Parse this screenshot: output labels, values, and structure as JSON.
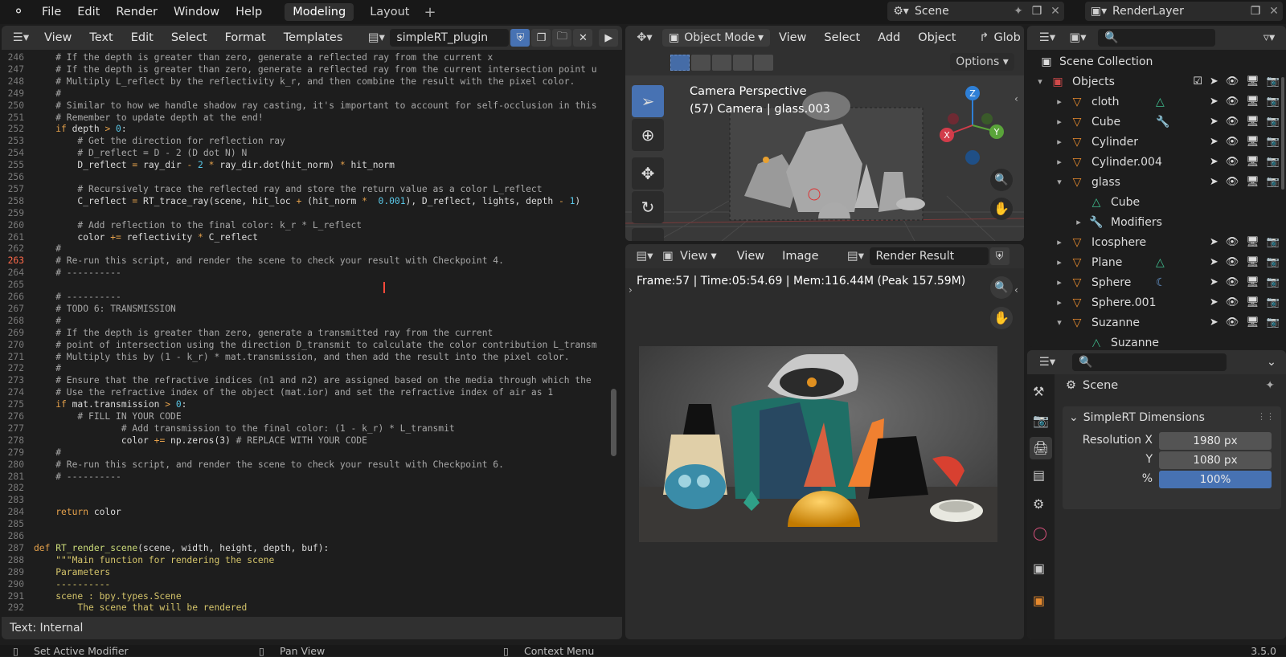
{
  "topbar": {
    "menus": [
      "File",
      "Edit",
      "Render",
      "Window",
      "Help"
    ],
    "workspaces": [
      "Modeling",
      "Layout"
    ],
    "scene": "Scene",
    "view_layer": "RenderLayer"
  },
  "text_editor": {
    "menus": [
      "View",
      "Text",
      "Edit",
      "Select",
      "Format",
      "Templates"
    ],
    "filename": "simpleRT_plugin",
    "status": "Text: Internal",
    "lines": [
      {
        "n": "246",
        "t": "    # If the depth is greater than zero, generate a reflected ray from the current x",
        "c": "cm"
      },
      {
        "n": "247",
        "t": "    # If the depth is greater than zero, generate a reflected ray from the current intersection point using",
        "c": "cm"
      },
      {
        "n": "248",
        "t": "    # Multiply L_reflect by the reflectivity k_r, and then combine the result with the pixel color.",
        "c": "cm"
      },
      {
        "n": "249",
        "t": "    #",
        "c": "cm"
      },
      {
        "n": "250",
        "t": "    # Similar to how we handle shadow ray casting, it's important to account for self-occlusion in this cont",
        "c": "cm"
      },
      {
        "n": "251",
        "t": "    # Remember to update depth at the end!",
        "c": "cm"
      },
      {
        "n": "252",
        "t": "    if depth > 0:",
        "c": "mix1"
      },
      {
        "n": "253",
        "t": "        # Get the direction for reflection ray",
        "c": "cm"
      },
      {
        "n": "254",
        "t": "        # D_reflect = D - 2 (D dot N) N",
        "c": "cm"
      },
      {
        "n": "255",
        "t": "        D_reflect = ray_dir - 2 * ray_dir.dot(hit_norm) * hit_norm",
        "c": "mix2"
      },
      {
        "n": "256",
        "t": "",
        "c": ""
      },
      {
        "n": "257",
        "t": "        # Recursively trace the reflected ray and store the return value as a color L_reflect",
        "c": "cm"
      },
      {
        "n": "258",
        "t": "        C_reflect = RT_trace_ray(scene, hit_loc + (hit_norm *  0.001), D_reflect, lights, depth - 1)",
        "c": "mix3"
      },
      {
        "n": "259",
        "t": "",
        "c": ""
      },
      {
        "n": "260",
        "t": "        # Add reflection to the final color: k_r * L_reflect",
        "c": "cm"
      },
      {
        "n": "261",
        "t": "        color += reflectivity * C_reflect",
        "c": "mix4"
      },
      {
        "n": "262",
        "t": "    #",
        "c": "cm"
      },
      {
        "n": "263",
        "t": "    # Re-run this script, and render the scene to check your result with Checkpoint 4.",
        "c": "cm"
      },
      {
        "n": "264",
        "t": "    # ----------",
        "c": "cm"
      },
      {
        "n": "265",
        "t": "",
        "c": ""
      },
      {
        "n": "266",
        "t": "    # ----------",
        "c": "cm"
      },
      {
        "n": "267",
        "t": "    # TODO 6: TRANSMISSION",
        "c": "cm"
      },
      {
        "n": "268",
        "t": "    #",
        "c": "cm"
      },
      {
        "n": "269",
        "t": "    # If the depth is greater than zero, generate a transmitted ray from the current",
        "c": "cm"
      },
      {
        "n": "270",
        "t": "    # point of intersection using the direction D_transmit to calculate the color contribution L_transmit.",
        "c": "cm"
      },
      {
        "n": "271",
        "t": "    # Multiply this by (1 - k_r) * mat.transmission, and then add the result into the pixel color.",
        "c": "cm"
      },
      {
        "n": "272",
        "t": "    #",
        "c": "cm"
      },
      {
        "n": "273",
        "t": "    # Ensure that the refractive indices (n1 and n2) are assigned based on the media through which the ray i",
        "c": "cm"
      },
      {
        "n": "274",
        "t": "    # Use the refractive index of the object (mat.ior) and set the refractive index of air as 1",
        "c": "cm"
      },
      {
        "n": "275",
        "t": "    if mat.transmission > 0:",
        "c": "mix5"
      },
      {
        "n": "276",
        "t": "        # FILL IN YOUR CODE",
        "c": "cm"
      },
      {
        "n": "277",
        "t": "                # Add transmission to the final color: (1 - k_r) * L_transmit",
        "c": "cm"
      },
      {
        "n": "278",
        "t": "                color += np.zeros(3) # REPLACE WITH YOUR CODE",
        "c": "mix6"
      },
      {
        "n": "279",
        "t": "    #",
        "c": "cm"
      },
      {
        "n": "280",
        "t": "    # Re-run this script, and render the scene to check your result with Checkpoint 6.",
        "c": "cm"
      },
      {
        "n": "281",
        "t": "    # ----------",
        "c": "cm"
      },
      {
        "n": "282",
        "t": "",
        "c": ""
      },
      {
        "n": "283",
        "t": "",
        "c": ""
      },
      {
        "n": "284",
        "t": "    return color",
        "c": "mix7"
      },
      {
        "n": "285",
        "t": "",
        "c": ""
      },
      {
        "n": "286",
        "t": "",
        "c": ""
      },
      {
        "n": "287",
        "t": "def RT_render_scene(scene, width, height, depth, buf):",
        "c": "mix8"
      },
      {
        "n": "288",
        "t": "    \"\"\"Main function for rendering the scene",
        "c": "st"
      },
      {
        "n": "289",
        "t": "    Parameters",
        "c": "st"
      },
      {
        "n": "290",
        "t": "    ----------",
        "c": "st"
      },
      {
        "n": "291",
        "t": "    scene : bpy.types.Scene",
        "c": "st"
      },
      {
        "n": "292",
        "t": "        The scene that will be rendered",
        "c": "st"
      }
    ],
    "current_line": "263"
  },
  "viewport": {
    "mode": "Object Mode",
    "menus": [
      "View",
      "Select",
      "Add",
      "Object"
    ],
    "transform": "Glob",
    "options": "Options",
    "overlay_title": "Camera Perspective",
    "overlay_sub": "(57) Camera | glass.003",
    "gizmo": {
      "x": "X",
      "y": "Y",
      "z": "Z"
    }
  },
  "image_editor": {
    "menus": [
      "View",
      "View",
      "Image"
    ],
    "image_name": "Render Result",
    "stats": "Frame:57 | Time:05:54.69 | Mem:116.44M (Peak 157.59M)"
  },
  "outliner": {
    "root": "Scene Collection",
    "items": [
      {
        "label": "Objects",
        "depth": 0,
        "type": "collection"
      },
      {
        "label": "cloth",
        "depth": 1,
        "type": "object",
        "badge": "mesh-data-icon"
      },
      {
        "label": "Cube",
        "depth": 1,
        "type": "object",
        "badge": "wrench-icon"
      },
      {
        "label": "Cylinder",
        "depth": 1,
        "type": "object",
        "badge": ""
      },
      {
        "label": "Cylinder.004",
        "depth": 1,
        "type": "object",
        "badge": ""
      },
      {
        "label": "glass",
        "depth": 1,
        "type": "object",
        "badge": ""
      },
      {
        "label": "Cube",
        "depth": 2,
        "type": "mesh",
        "badge": ""
      },
      {
        "label": "Modifiers",
        "depth": 2,
        "type": "modifiers",
        "badge": ""
      },
      {
        "label": "Icosphere",
        "depth": 1,
        "type": "object",
        "badge": ""
      },
      {
        "label": "Plane",
        "depth": 1,
        "type": "object",
        "badge": "mesh-data-icon"
      },
      {
        "label": "Sphere",
        "depth": 1,
        "type": "object",
        "badge": "material-icon"
      },
      {
        "label": "Sphere.001",
        "depth": 1,
        "type": "object",
        "badge": ""
      },
      {
        "label": "Suzanne",
        "depth": 1,
        "type": "object",
        "badge": ""
      },
      {
        "label": "Suzanne",
        "depth": 2,
        "type": "mesh",
        "badge": ""
      }
    ]
  },
  "properties": {
    "context": "Scene",
    "panel_title": "SimpleRT Dimensions",
    "fields": [
      {
        "label": "Resolution X",
        "value": "1980 px"
      },
      {
        "label": "Y",
        "value": "1080 px"
      },
      {
        "label": "%",
        "value": "100%"
      }
    ],
    "percent_level": 1.0
  },
  "footer": {
    "hints": [
      "Set Active Modifier",
      "Pan View",
      "Context Menu"
    ],
    "version": "3.5.0"
  },
  "colors": {
    "accent": "#4772b3",
    "object_orange": "#e68a2e",
    "mesh_green": "#3fbf8f"
  }
}
